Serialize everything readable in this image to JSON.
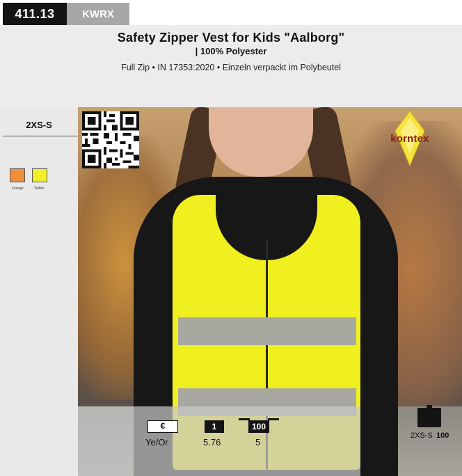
{
  "header": {
    "article_number": "411.13",
    "article_code": "KWRX"
  },
  "product": {
    "title": "Safety Zipper Vest for Kids \"Aalborg\"",
    "material": "| 100% Polyester",
    "features": "Full Zip • IN 17353:2020 • Einzeln verpackt im Polybeutel"
  },
  "sizes": {
    "label": "2XS-S"
  },
  "colors": [
    {
      "name": "Orange",
      "hex": "#f28f3b"
    },
    {
      "name": "Yellow",
      "hex": "#f2ee2a"
    }
  ],
  "brand": {
    "name": "korntex",
    "icon": "korntex-logo"
  },
  "qr": {
    "icon": "qr-code-icon"
  },
  "pricing": {
    "currency_symbol": "€",
    "color_code": "Ye/Or",
    "tiers": [
      {
        "qty": "1",
        "price": "5.76"
      },
      {
        "qty": "100",
        "price": "5"
      }
    ]
  },
  "carton": {
    "icon": "carton-icon",
    "size": "2XS-S",
    "qty": "100"
  }
}
